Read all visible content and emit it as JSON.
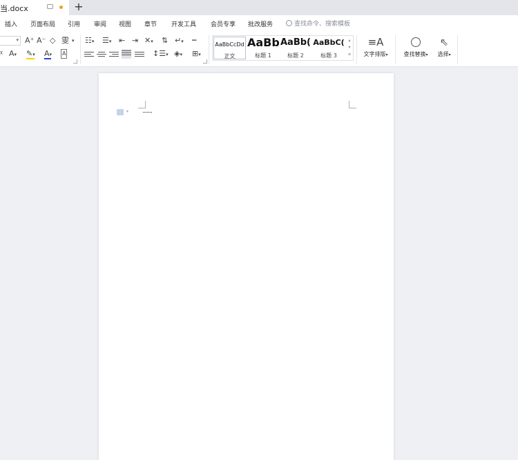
{
  "tab": {
    "doc_name": "当.docx",
    "unsaved_dot_color": "#f0a020"
  },
  "menu": {
    "items": [
      "插入",
      "页面布局",
      "引用",
      "审阅",
      "视图",
      "章节",
      "开发工具",
      "会员专享",
      "批改服务"
    ],
    "search_placeholder": "查找命令、搜索模板"
  },
  "ribbon": {
    "font_icons": {
      "grow": "A⁺",
      "shrink": "A⁻",
      "clear": "◇",
      "phonetic": "雯"
    },
    "styles": [
      {
        "sample": "AaBbCcDd",
        "label": "正文"
      },
      {
        "sample": "AaBb",
        "label": "标题 1"
      },
      {
        "sample": "AaBb(",
        "label": "标题 2"
      },
      {
        "sample": "AaBbC(",
        "label": "标题 3"
      }
    ],
    "text_layout_label": "文字排版",
    "find_replace_label": "查找替换",
    "select_label": "选择"
  },
  "colors": {
    "font_color_bar": "#2a3fd6",
    "highlight_bar": "#f5d200"
  }
}
